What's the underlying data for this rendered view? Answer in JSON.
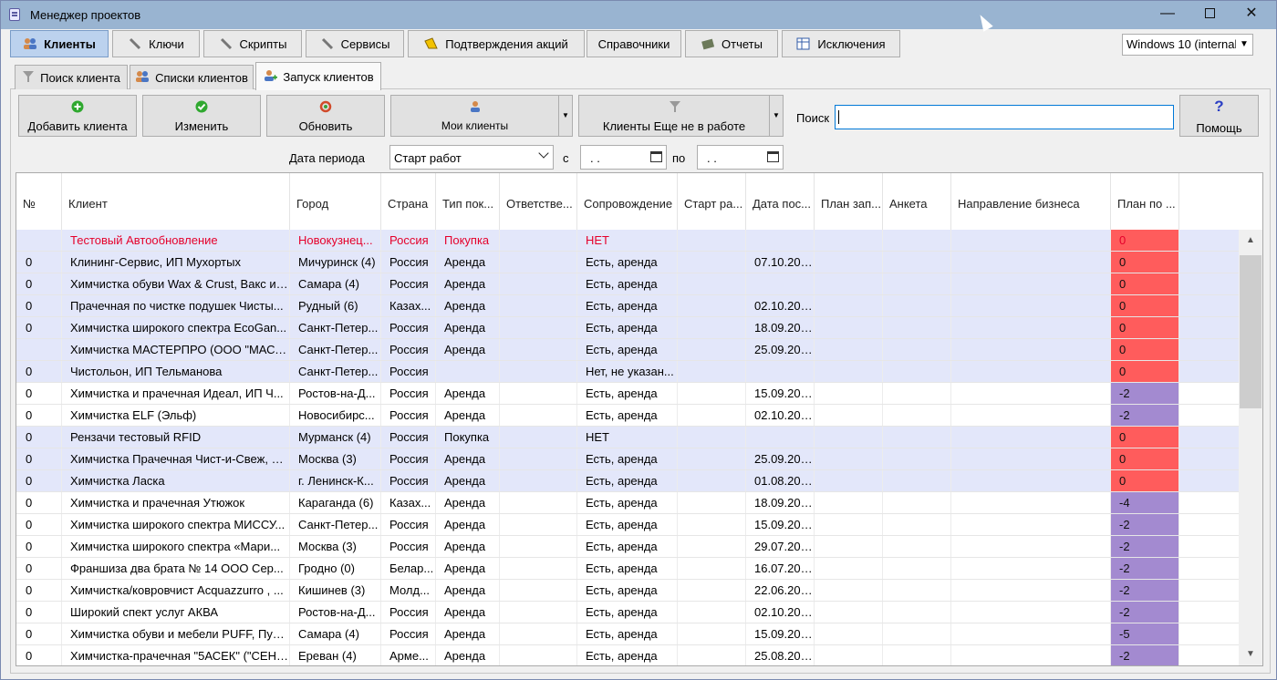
{
  "window": {
    "title": "Менеджер проектов"
  },
  "colors": {
    "titlebar": "#99b4d1",
    "active_tab": "#bcd2ee",
    "plan_red": "#ff5c5c",
    "plan_purple": "#a38ad0",
    "highlight_row": "#e3e7fa",
    "text_red": "#e5002b"
  },
  "top_tabs": [
    {
      "label": "Клиенты",
      "icon": "users-icon"
    },
    {
      "label": "Ключи",
      "icon": "wrench-icon"
    },
    {
      "label": "Скрипты",
      "icon": "wrench-icon"
    },
    {
      "label": "Сервисы",
      "icon": "wrench-icon"
    },
    {
      "label": "Подтверждения акций",
      "icon": "horn-icon"
    },
    {
      "label": "Справочники",
      "icon": ""
    },
    {
      "label": "Отчеты",
      "icon": "book-icon"
    },
    {
      "label": "Исключения",
      "icon": "table-icon"
    }
  ],
  "os_select": {
    "value": "Windows 10 (internal"
  },
  "sub_tabs": [
    {
      "label": "Поиск клиента",
      "icon": "filter-icon"
    },
    {
      "label": "Списки клиентов",
      "icon": "users-icon"
    },
    {
      "label": "Запуск клиентов",
      "icon": "user-add-icon"
    }
  ],
  "toolbar": {
    "add": "Добавить клиента",
    "edit": "Изменить",
    "refresh": "Обновить",
    "my_clients": "Мои клиенты",
    "not_in_work": "Клиенты Еще не в работе",
    "search_label": "Поиск",
    "search_value": "",
    "help": "Помощь",
    "help_glyph": "?"
  },
  "period": {
    "label": "Дата периода",
    "select": "Старт работ",
    "from_label": "с",
    "from_value": ". .",
    "to_label": "по",
    "to_value": ". ."
  },
  "columns": [
    "№",
    "Клиент",
    "Город",
    "Страна",
    "Тип пок...",
    "Ответстве...",
    "Сопровождение",
    "Старт ра...",
    "Дата пос...",
    "План зап...",
    "Анкета",
    "Направление бизнеса",
    "План по ..."
  ],
  "rows": [
    {
      "num": "",
      "client": "Тестовый Автообновление",
      "city": "Новокузнец...",
      "country": "Россия",
      "type": "Покупка",
      "resp": "",
      "support": "НЕТ",
      "start": "",
      "date": "",
      "plan": "",
      "anketa": "",
      "business": "",
      "planp": "0",
      "plan_color": "red",
      "style": "red"
    },
    {
      "num": "0",
      "client": "Клининг-Сервис, ИП Мухортых",
      "city": "Мичуринск (4)",
      "country": "Россия",
      "type": "Аренда",
      "resp": "",
      "support": "Есть, аренда",
      "start": "",
      "date": "07.10.2020",
      "plan": "",
      "anketa": "",
      "business": "",
      "planp": "0",
      "plan_color": "red",
      "style": "hl"
    },
    {
      "num": "0",
      "client": "Химчистка обуви Wax & Crust, Вакс и ...",
      "city": "Самара (4)",
      "country": "Россия",
      "type": "Аренда",
      "resp": "",
      "support": "Есть, аренда",
      "start": "",
      "date": "",
      "plan": "",
      "anketa": "",
      "business": "",
      "planp": "0",
      "plan_color": "red",
      "style": "hl"
    },
    {
      "num": "0",
      "client": "Прачечная по чистке подушек Чисты...",
      "city": "Рудный (6)",
      "country": "Казах...",
      "type": "Аренда",
      "resp": "",
      "support": "Есть, аренда",
      "start": "",
      "date": "02.10.2020",
      "plan": "",
      "anketa": "",
      "business": "",
      "planp": "0",
      "plan_color": "red",
      "style": "hl"
    },
    {
      "num": "0",
      "client": "Химчистка широкого спектра EcoGan...",
      "city": "Санкт-Петер...",
      "country": "Россия",
      "type": "Аренда",
      "resp": "",
      "support": "Есть, аренда",
      "start": "",
      "date": "18.09.2020",
      "plan": "",
      "anketa": "",
      "business": "",
      "planp": "0",
      "plan_color": "red",
      "style": "hl"
    },
    {
      "num": "",
      "client": "Химчистка МАСТЕРПРО (ООО \"МАСТ...",
      "city": "Санкт-Петер...",
      "country": "Россия",
      "type": "Аренда",
      "resp": "",
      "support": "Есть, аренда",
      "start": "",
      "date": "25.09.2020",
      "plan": "",
      "anketa": "",
      "business": "",
      "planp": "0",
      "plan_color": "red",
      "style": "hl"
    },
    {
      "num": "0",
      "client": "Чистольон, ИП Тельманова",
      "city": "Санкт-Петер...",
      "country": "Россия",
      "type": "",
      "resp": "",
      "support": "Нет, не указан...",
      "start": "",
      "date": "",
      "plan": "",
      "anketa": "",
      "business": "",
      "planp": "0",
      "plan_color": "red",
      "style": "hl"
    },
    {
      "num": "0",
      "client": "Химчистка и прачечная Идеал, ИП Ч...",
      "city": "Ростов-на-Д...",
      "country": "Россия",
      "type": "Аренда",
      "resp": "",
      "support": "Есть, аренда",
      "start": "",
      "date": "15.09.2020",
      "plan": "",
      "anketa": "",
      "business": "",
      "planp": "-2",
      "plan_color": "purple",
      "style": ""
    },
    {
      "num": "0",
      "client": "Химчистка ELF (Эльф)",
      "city": "Новосибирс...",
      "country": "Россия",
      "type": "Аренда",
      "resp": "",
      "support": "Есть, аренда",
      "start": "",
      "date": "02.10.2020",
      "plan": "",
      "anketa": "",
      "business": "",
      "planp": "-2",
      "plan_color": "purple",
      "style": ""
    },
    {
      "num": "0",
      "client": " Рензачи тестовый RFID",
      "city": "Мурманск (4)",
      "country": "Россия",
      "type": "Покупка",
      "resp": "",
      "support": "НЕТ",
      "start": "",
      "date": "",
      "plan": "",
      "anketa": "",
      "business": "",
      "planp": "0",
      "plan_color": "red",
      "style": "hl"
    },
    {
      "num": "0",
      "client": "Химчистка Прачечная Чист-и-Свеж, И...",
      "city": "Москва (3)",
      "country": "Россия",
      "type": "Аренда",
      "resp": "",
      "support": "Есть, аренда",
      "start": "",
      "date": "25.09.2020",
      "plan": "",
      "anketa": "",
      "business": "",
      "planp": "0",
      "plan_color": "red",
      "style": "hl"
    },
    {
      "num": "0",
      "client": "Химчистка Ласка",
      "city": "г. Ленинск-К...",
      "country": "Россия",
      "type": "Аренда",
      "resp": "",
      "support": "Есть, аренда",
      "start": "",
      "date": "01.08.2019",
      "plan": "",
      "anketa": "",
      "business": "",
      "planp": "0",
      "plan_color": "red",
      "style": "hl"
    },
    {
      "num": "0",
      "client": "Химчистка и прачечная Утюжок",
      "city": "Караганда (6)",
      "country": "Казах...",
      "type": "Аренда",
      "resp": "",
      "support": "Есть, аренда",
      "start": "",
      "date": "18.09.2020",
      "plan": "",
      "anketa": "",
      "business": "",
      "planp": "-4",
      "plan_color": "purple",
      "style": ""
    },
    {
      "num": "0",
      "client": "Химчистка широкого спектра МИССУ...",
      "city": "Санкт-Петер...",
      "country": "Россия",
      "type": "Аренда",
      "resp": "",
      "support": "Есть, аренда",
      "start": "",
      "date": "15.09.2020",
      "plan": "",
      "anketa": "",
      "business": "",
      "planp": "-2",
      "plan_color": "purple",
      "style": ""
    },
    {
      "num": "0",
      "client": "Химчистка широкого спектра «Мари...",
      "city": "Москва (3)",
      "country": "Россия",
      "type": "Аренда",
      "resp": "",
      "support": "Есть, аренда",
      "start": "",
      "date": "29.07.2020",
      "plan": "",
      "anketa": "",
      "business": "",
      "planp": "-2",
      "plan_color": "purple",
      "style": ""
    },
    {
      "num": "0",
      "client": "Франшиза два брата № 14 ООО Сер...",
      "city": "Гродно (0)",
      "country": "Белар...",
      "type": "Аренда",
      "resp": "",
      "support": "Есть, аренда",
      "start": "",
      "date": "16.07.2020",
      "plan": "",
      "anketa": "",
      "business": "",
      "planp": "-2",
      "plan_color": "purple",
      "style": ""
    },
    {
      "num": "0",
      "client": "Химчистка/ковровчист Acquazzurro , ...",
      "city": "Кишинев (3)",
      "country": "Молд...",
      "type": "Аренда",
      "resp": "",
      "support": "Есть, аренда",
      "start": "",
      "date": "22.06.2020",
      "plan": "",
      "anketa": "",
      "business": "",
      "planp": "-2",
      "plan_color": "purple",
      "style": ""
    },
    {
      "num": "0",
      "client": "Широкий спект услуг АКВА",
      "city": "Ростов-на-Д...",
      "country": "Россия",
      "type": "Аренда",
      "resp": "",
      "support": "Есть, аренда",
      "start": "",
      "date": "02.10.2020",
      "plan": "",
      "anketa": "",
      "business": "",
      "planp": "-2",
      "plan_color": "purple",
      "style": ""
    },
    {
      "num": "0",
      "client": "Химчистка обуви и мебели PUFF, Пуф...",
      "city": "Самара (4)",
      "country": "Россия",
      "type": "Аренда",
      "resp": "",
      "support": "Есть, аренда",
      "start": "",
      "date": "15.09.2020",
      "plan": "",
      "anketa": "",
      "business": "",
      "planp": "-5",
      "plan_color": "purple",
      "style": ""
    },
    {
      "num": "0",
      "client": "Химчистка-прачечная \"5АСЕК\" (\"СЕНК...",
      "city": "Ереван (4)",
      "country": "Арме...",
      "type": "Аренда",
      "resp": "",
      "support": "Есть, аренда",
      "start": "",
      "date": "25.08.2020",
      "plan": "",
      "anketa": "",
      "business": "",
      "planp": "-2",
      "plan_color": "purple",
      "style": ""
    }
  ]
}
